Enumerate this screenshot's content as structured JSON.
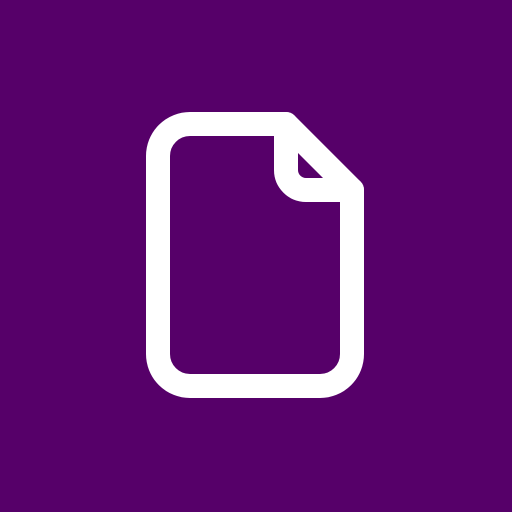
{
  "icon": {
    "name": "document-icon",
    "background_color": "#560069",
    "foreground_color": "#ffffff"
  }
}
